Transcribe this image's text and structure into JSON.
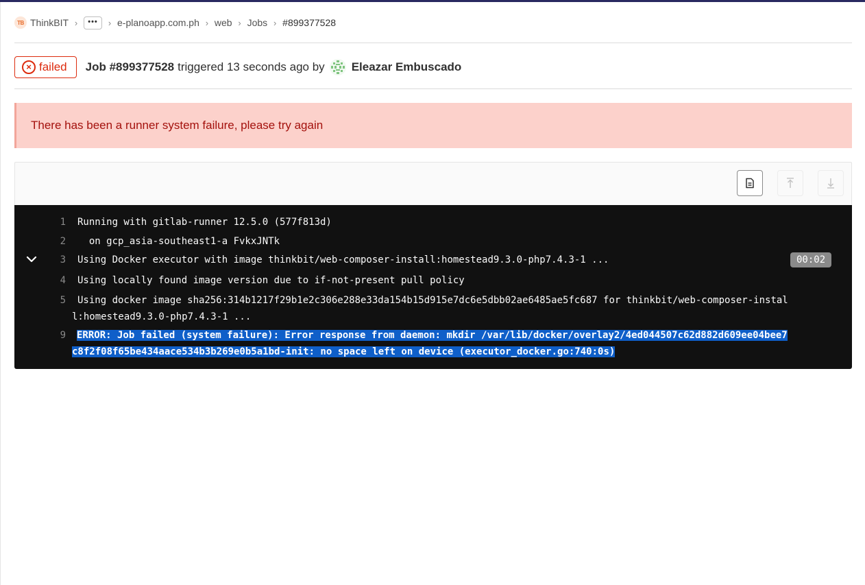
{
  "breadcrumb": {
    "logo_text": "TB",
    "group": "ThinkBIT",
    "ellipsis": "•••",
    "project_group": "e-planoapp.com.ph",
    "project": "web",
    "section": "Jobs",
    "current": "#899377528",
    "separator": "›"
  },
  "job": {
    "status": "failed",
    "status_icon": "×",
    "title": "Job #899377528",
    "triggered_text": "triggered 13 seconds ago by",
    "user_name": "Eleazar Embuscado"
  },
  "alert": {
    "message": "There has been a runner system failure, please try again"
  },
  "toolbar": {
    "raw_icon": "file-text-icon",
    "scroll_top_icon": "scroll-up-icon",
    "scroll_bottom_icon": "scroll-down-icon"
  },
  "log": {
    "section_duration": "00:02",
    "lines": [
      {
        "num": "1",
        "text": "Running with gitlab-runner 12.5.0 (577f813d)"
      },
      {
        "num": "2",
        "text": "  on gcp_asia-southeast1-a FvkxJNTk"
      },
      {
        "num": "3",
        "text": "Using Docker executor with image thinkbit/web-composer-install:homestead9.3.0-php7.4.3-1 ..."
      },
      {
        "num": "4",
        "text": "Using locally found image version due to if-not-present pull policy"
      },
      {
        "num": "5",
        "text": "Using docker image sha256:314b1217f29b1e2c306e288e33da154b15d915e7dc6e5dbb02ae6485ae5fc687 for thinkbit/web-composer-instal",
        "text2": "l:homestead9.3.0-php7.4.3-1 ..."
      },
      {
        "num": "9",
        "text": "ERROR: Job failed (system failure): Error response from daemon: mkdir /var/lib/docker/overlay2/4ed044507c62d882d609ee04bee7",
        "text2": "c8f2f08f65be434aace534b3b269e0b5a1bd-init: no space left on device (executor_docker.go:740:0s)"
      }
    ]
  },
  "colors": {
    "failed": "#dd2b0e",
    "alert_bg": "#fcd1cb",
    "alert_text": "#a4110d",
    "log_bg": "#111111",
    "selection": "#0f5fc9"
  }
}
